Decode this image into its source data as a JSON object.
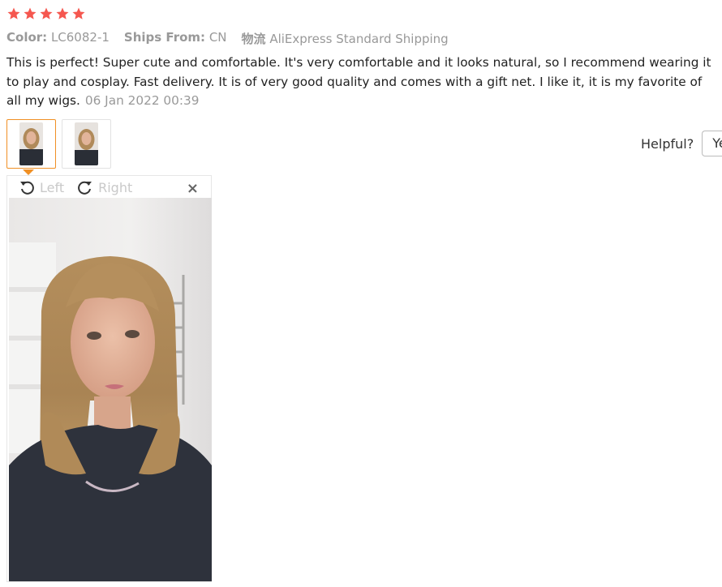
{
  "rating": {
    "stars": 5,
    "color": "#f5574f"
  },
  "meta": {
    "color_label": "Color:",
    "color_value": "LC6082-1",
    "ships_label": "Ships From:",
    "ships_value": "CN",
    "logistics_label": "物流",
    "logistics_value": "AliExpress Standard Shipping"
  },
  "review": {
    "text": "This is perfect! Super cute and comfortable. It's very comfortable and it looks natural, so I recommend wearing it to play and cosplay. Fast delivery. It is of very good quality and comes with a gift net. I like it, it is my favorite of all my wigs.",
    "date": "06 Jan 2022 00:39"
  },
  "helpful": {
    "label": "Helpful?",
    "yes_label": "Yes"
  },
  "viewer": {
    "rotate_left": "Left",
    "rotate_right": "Right",
    "close": "×"
  },
  "colors": {
    "accent": "#f09025",
    "muted": "#999999"
  }
}
